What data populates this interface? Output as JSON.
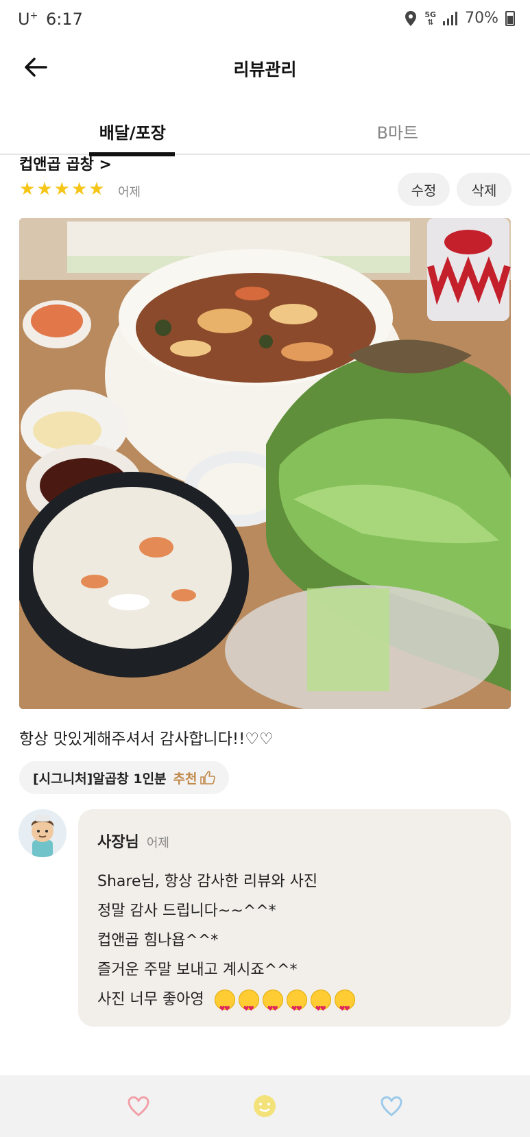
{
  "status_bar": {
    "carrier": "U",
    "carrier_sup": "+",
    "time": "6:17",
    "network": "5G",
    "battery": "70%"
  },
  "header": {
    "title": "리뷰관리"
  },
  "tabs": [
    {
      "label": "배달/포장",
      "active": true
    },
    {
      "label": "B마트",
      "active": false
    }
  ],
  "review": {
    "store_name": "컵앤곱 곱창 >",
    "rating": 5,
    "date": "어제",
    "edit_label": "수정",
    "delete_label": "삭제",
    "text": "항상 맛있게해주셔서 감사합니다!!♡♡",
    "menu_item": "[시그니처]알곱창 1인분",
    "recommend_label": "추천"
  },
  "owner_reply": {
    "name": "사장님",
    "date": "어제",
    "lines": [
      "Share님, 항상 감사한 리뷰와 사진",
      "정말 감사 드립니다~~^^*",
      "컵앤곱 힘나욥^^*",
      "즐거운 주말 보내고 계시죠^^*",
      "사진 너무 좋아영"
    ],
    "emoji_count": 6
  },
  "bottom_nav": [
    {
      "icon": "heart-pink-icon",
      "color": "#f2a0a8"
    },
    {
      "icon": "smile-yellow-icon",
      "color": "#f0dc6a"
    },
    {
      "icon": "heart-blue-icon",
      "color": "#9cc9ea"
    }
  ],
  "colors": {
    "star": "#f5c518",
    "recommend": "#c08a4c",
    "reply_bg": "#f2efea"
  }
}
